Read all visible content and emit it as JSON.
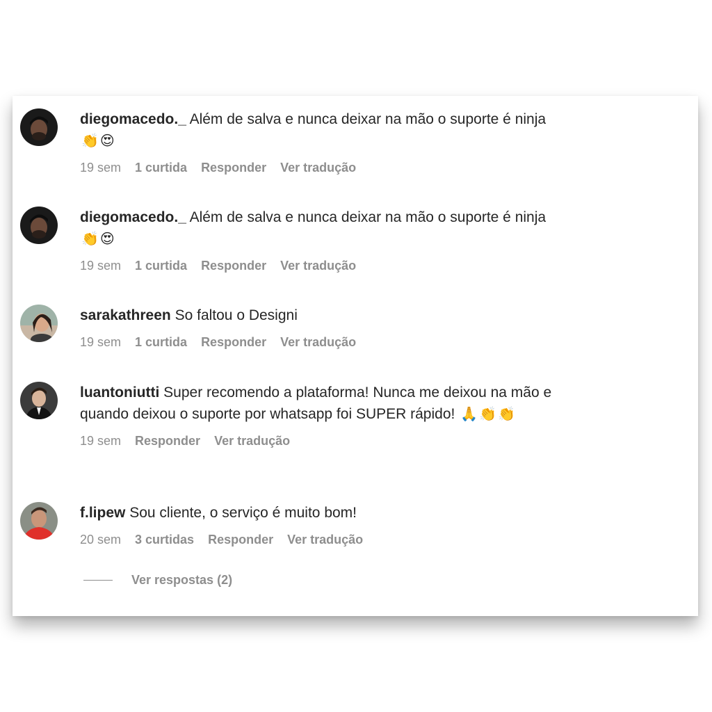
{
  "comments": [
    {
      "username": "diegomacedo._",
      "text": "Além de salva e nunca deixar na mão o suporte é ninja",
      "emojis": [
        "👏",
        "😍"
      ],
      "time": "19 sem",
      "likes": "1 curtida",
      "reply_label": "Responder",
      "translate_label": "Ver tradução"
    },
    {
      "username": "diegomacedo._",
      "text": "Além de salva e nunca deixar na mão o suporte é ninja",
      "emojis": [
        "👏",
        "😍"
      ],
      "time": "19 sem",
      "likes": "1 curtida",
      "reply_label": "Responder",
      "translate_label": "Ver tradução"
    },
    {
      "username": "sarakathreen",
      "text": "So faltou o Designi",
      "emojis": [],
      "time": "19 sem",
      "likes": "1 curtida",
      "reply_label": "Responder",
      "translate_label": "Ver tradução"
    },
    {
      "username": "luantoniutti",
      "text": "Super recomendo a plataforma! Nunca me deixou na mão e quando deixou o suporte por whatsapp foi SUPER rápido!",
      "emojis": [
        "🙏",
        "👏",
        "👏"
      ],
      "time": "19 sem",
      "likes": "",
      "reply_label": "Responder",
      "translate_label": "Ver tradução"
    },
    {
      "username": "f.lipew",
      "text": "Sou cliente, o serviço é muito bom!",
      "emojis": [],
      "time": "20 sem",
      "likes": "3 curtidas",
      "reply_label": "Responder",
      "translate_label": "Ver tradução"
    }
  ],
  "view_replies": {
    "label": "Ver respostas (2)"
  },
  "colors": {
    "text": "#262626",
    "muted": "#8e8e8e",
    "background": "#ffffff"
  }
}
